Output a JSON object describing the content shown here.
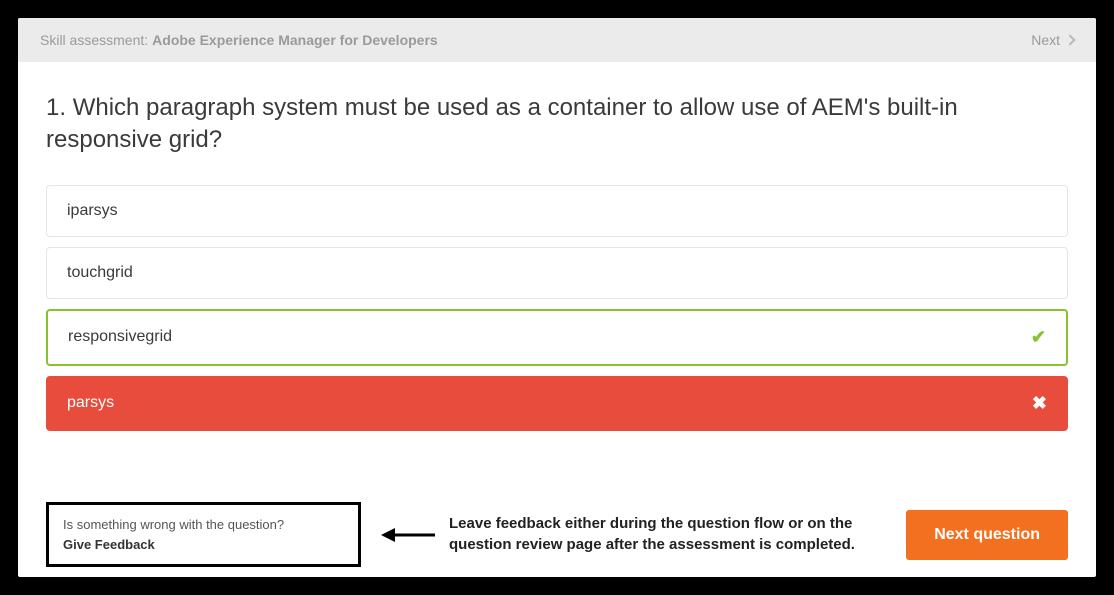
{
  "topbar": {
    "prefix": "Skill assessment:",
    "title": "Adobe Experience Manager for Developers",
    "next_label": "Next"
  },
  "question": {
    "number_prefix": "1.",
    "text": "Which paragraph system must be used as a container to allow use of AEM's built-in responsive grid?"
  },
  "options": [
    {
      "label": "iparsys",
      "state": "default"
    },
    {
      "label": "touchgrid",
      "state": "default"
    },
    {
      "label": "responsivegrid",
      "state": "correct"
    },
    {
      "label": "parsys",
      "state": "incorrect"
    }
  ],
  "feedback": {
    "prompt": "Is something wrong with the question?",
    "link": "Give Feedback"
  },
  "annotation": {
    "text": "Leave feedback either during the question flow or on the question review page after the assessment is completed."
  },
  "actions": {
    "next_question": "Next question"
  }
}
